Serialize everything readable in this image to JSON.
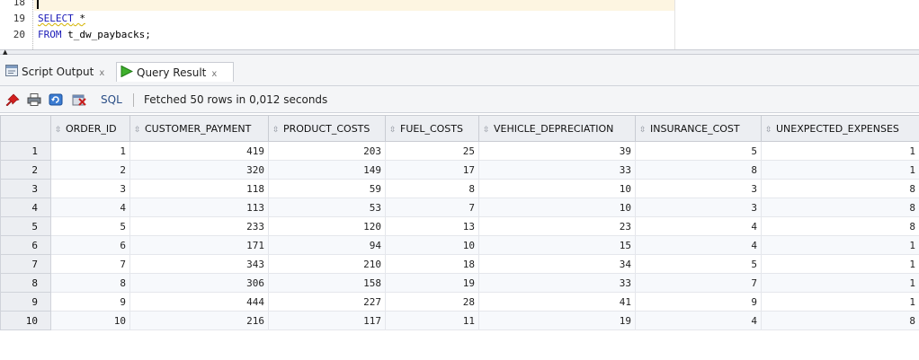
{
  "editor": {
    "lines": [
      {
        "num": "18",
        "text": ""
      },
      {
        "num": "19",
        "keyword": "SELECT",
        "rest": " *"
      },
      {
        "num": "20",
        "keyword": "FROM",
        "rest": " t_dw_paybacks;"
      }
    ]
  },
  "tabs": [
    {
      "label": "Script Output",
      "icon": "script-output-icon",
      "close": "x"
    },
    {
      "label": "Query Result",
      "icon": "play-icon",
      "close": "x"
    }
  ],
  "toolbar": {
    "sql_label": "SQL",
    "status": "Fetched 50 rows in 0,012 seconds",
    "icons": [
      "pin-icon",
      "print-icon",
      "refresh-icon",
      "cancel-query-icon"
    ]
  },
  "table": {
    "columns": [
      "ORDER_ID",
      "CUSTOMER_PAYMENT",
      "PRODUCT_COSTS",
      "FUEL_COSTS",
      "VEHICLE_DEPRECIATION",
      "INSURANCE_COST",
      "UNEXPECTED_EXPENSES"
    ],
    "rows": [
      [
        "1",
        "1",
        "419",
        "203",
        "25",
        "39",
        "5",
        "1"
      ],
      [
        "2",
        "2",
        "320",
        "149",
        "17",
        "33",
        "8",
        "1"
      ],
      [
        "3",
        "3",
        "118",
        "59",
        "8",
        "10",
        "3",
        "8"
      ],
      [
        "4",
        "4",
        "113",
        "53",
        "7",
        "10",
        "3",
        "8"
      ],
      [
        "5",
        "5",
        "233",
        "120",
        "13",
        "23",
        "4",
        "8"
      ],
      [
        "6",
        "6",
        "171",
        "94",
        "10",
        "15",
        "4",
        "1"
      ],
      [
        "7",
        "7",
        "343",
        "210",
        "18",
        "34",
        "5",
        "1"
      ],
      [
        "8",
        "8",
        "306",
        "158",
        "19",
        "33",
        "7",
        "1"
      ],
      [
        "9",
        "9",
        "444",
        "227",
        "28",
        "41",
        "9",
        "1"
      ],
      [
        "10",
        "10",
        "216",
        "117",
        "11",
        "19",
        "4",
        "8"
      ]
    ]
  }
}
